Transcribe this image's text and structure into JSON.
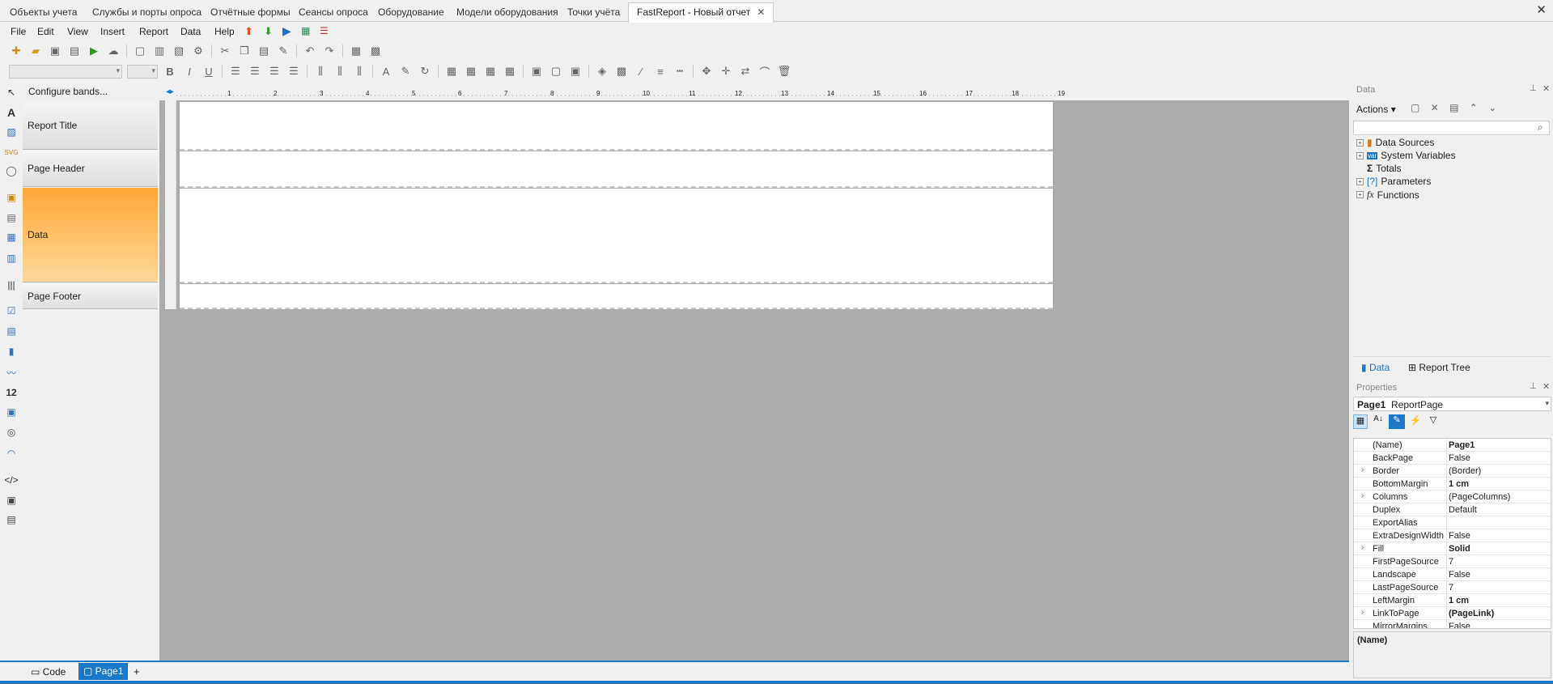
{
  "tabs": [
    {
      "label": "Объекты учета",
      "active": false
    },
    {
      "label": "Службы и порты опроса",
      "active": false
    },
    {
      "label": "Отчётные формы",
      "active": false
    },
    {
      "label": "Сеансы опроса",
      "active": false
    },
    {
      "label": "Оборудование",
      "active": false
    },
    {
      "label": "Модели оборудования",
      "active": false
    },
    {
      "label": "Точки учёта",
      "active": false
    },
    {
      "label": "FastReport - Новый отчет",
      "active": true
    }
  ],
  "tab_close_glyph": "✕",
  "window_close_glyph": "✕",
  "menu": [
    "File",
    "Edit",
    "View",
    "Insert",
    "Report",
    "Data",
    "Help"
  ],
  "configure_bands": "Configure bands...",
  "bands": [
    {
      "label": "Report Title",
      "selected": false
    },
    {
      "label": "Page Header",
      "selected": false
    },
    {
      "label": "Data",
      "selected": true
    },
    {
      "label": "Page Footer",
      "selected": false
    }
  ],
  "ruler_marks": [
    "1",
    "2",
    "3",
    "4",
    "5",
    "6",
    "7",
    "8",
    "9",
    "10",
    "11",
    "12",
    "13",
    "14",
    "15",
    "16",
    "17",
    "18",
    "19"
  ],
  "data_panel": {
    "title": "Data",
    "actions": "Actions",
    "search_placeholder": "",
    "tree": [
      "Data Sources",
      "System Variables",
      "Totals",
      "Parameters",
      "Functions"
    ],
    "tabs": [
      "Data",
      "Report Tree"
    ]
  },
  "properties_panel": {
    "title": "Properties",
    "object_name": "Page1",
    "object_type": "ReportPage",
    "rows": [
      {
        "name": "(Name)",
        "value": "Page1",
        "bold": true,
        "expandable": false
      },
      {
        "name": "BackPage",
        "value": "False",
        "bold": false,
        "expandable": false
      },
      {
        "name": "Border",
        "value": "(Border)",
        "bold": false,
        "expandable": true
      },
      {
        "name": "BottomMargin",
        "value": "1 cm",
        "bold": true,
        "expandable": false
      },
      {
        "name": "Columns",
        "value": "(PageColumns)",
        "bold": false,
        "expandable": true
      },
      {
        "name": "Duplex",
        "value": "Default",
        "bold": false,
        "expandable": false
      },
      {
        "name": "ExportAlias",
        "value": "",
        "bold": false,
        "expandable": false
      },
      {
        "name": "ExtraDesignWidth",
        "value": "False",
        "bold": false,
        "expandable": false
      },
      {
        "name": "Fill",
        "value": "Solid",
        "bold": true,
        "expandable": true
      },
      {
        "name": "FirstPageSource",
        "value": "7",
        "bold": false,
        "expandable": false
      },
      {
        "name": "Landscape",
        "value": "False",
        "bold": false,
        "expandable": false
      },
      {
        "name": "LastPageSource",
        "value": "7",
        "bold": false,
        "expandable": false
      },
      {
        "name": "LeftMargin",
        "value": "1 cm",
        "bold": true,
        "expandable": false
      },
      {
        "name": "LinkToPage",
        "value": "(PageLink)",
        "bold": true,
        "expandable": true
      },
      {
        "name": "MirrorMargins",
        "value": "False",
        "bold": false,
        "expandable": false
      }
    ],
    "description": "(Name)"
  },
  "bottom_tabs": {
    "code": "Code",
    "page": "Page1",
    "add": "+"
  },
  "colors": {
    "accent": "#1b78c8",
    "band_selected": "#ffa835",
    "workspace": "#ababab"
  }
}
